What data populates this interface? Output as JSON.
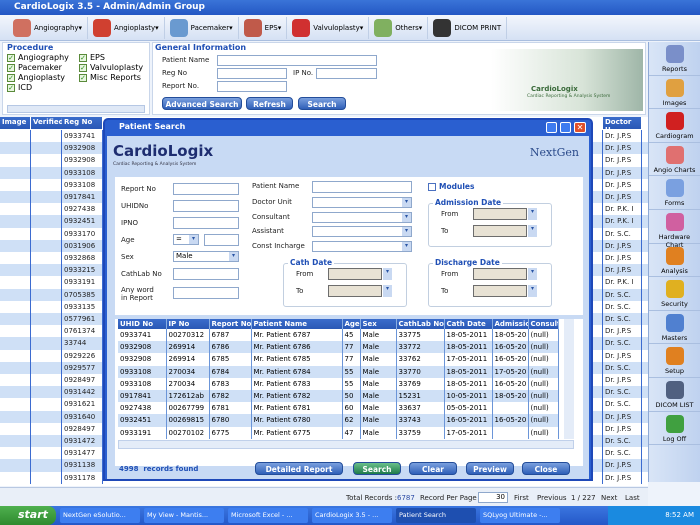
{
  "app": {
    "title": "CardioLogix 3.5 - Admin/Admin Group"
  },
  "toolbar": [
    {
      "label": "Angiography",
      "icon": "heart-angiography-icon",
      "dd": true
    },
    {
      "label": "Angioplasty",
      "icon": "heart-angioplasty-icon",
      "dd": true
    },
    {
      "label": "Pacemaker",
      "icon": "pacemaker-icon",
      "dd": true
    },
    {
      "label": "EPS",
      "icon": "eps-icon",
      "dd": true
    },
    {
      "label": "Valvuloplasty",
      "icon": "valve-icon",
      "dd": true
    },
    {
      "label": "Others",
      "icon": "notepad-icon",
      "dd": true
    },
    {
      "label": "DICOM PRINT",
      "icon": "dicom-grid-icon",
      "dd": false
    }
  ],
  "procedure": {
    "title": "Procedure",
    "items": [
      "Angiography",
      "EPS",
      "Pacemaker",
      "Valvuloplasty",
      "Angioplasty",
      "Misc Reports",
      "ICD"
    ]
  },
  "general": {
    "title": "General Information",
    "patient_name": "Patient Name",
    "reg_no": "Reg No",
    "ip_no": "IP No.",
    "report_no": "Report No.",
    "advanced": "Advanced Search",
    "refresh": "Refresh",
    "search": "Search"
  },
  "banner": {
    "brand": "CardioLogix",
    "sub": "Cardiac Reporting & Analysis System"
  },
  "grid": {
    "headers": [
      "Image",
      "Verified",
      "Reg No",
      "Doctor U"
    ],
    "regno": [
      "0933741",
      "0932908",
      "0932908",
      "0933108",
      "0933108",
      "0917841",
      "0927438",
      "0932451",
      "0933170",
      "0031906",
      "0932868",
      "0933215",
      "0933191",
      "0705385",
      "0933135",
      "0577961",
      "0761374",
      "33744",
      "0929226",
      "0929577",
      "0928497",
      "0931442",
      "0931621",
      "0931640",
      "0928497",
      "0931472",
      "0931477",
      "0931138",
      "0931178"
    ],
    "doctor": [
      "Dr. J.P.S",
      "Dr. J.P.S",
      "Dr. J.P.S",
      "Dr. J.P.S",
      "Dr. J.P.S",
      "Dr. J.P.S",
      "Dr. P.K. I",
      "Dr. P.K. I",
      "Dr. S.C.",
      "Dr. J.P.S",
      "Dr. J.P.S",
      "Dr. J.P.S",
      "Dr. P.K. I",
      "Dr. S.C.",
      "Dr. S.C.",
      "Dr. S.C.",
      "Dr. J.P.S",
      "Dr. S.C.",
      "Dr. J.P.S",
      "Dr. S.C.",
      "Dr. J.P.S",
      "Dr. S.C.",
      "Dr. S.C.",
      "Dr. J.P.S",
      "Dr. J.P.S",
      "Dr. S.C.",
      "Dr. S.C.",
      "Dr. J.P.S",
      "Dr. J.P.S"
    ]
  },
  "sidebar": [
    {
      "label": "Reports",
      "color": "#7a8fc9"
    },
    {
      "label": "Images",
      "color": "#e0a040"
    },
    {
      "label": "Cardiogram",
      "color": "#d02020"
    },
    {
      "label": "Angio Charts",
      "color": "#e07070"
    },
    {
      "label": "Forms",
      "color": "#7aa0e0"
    },
    {
      "label": "Hardware Chart",
      "color": "#d060a0"
    },
    {
      "label": "Analysis",
      "color": "#e08020"
    },
    {
      "label": "Security",
      "color": "#e0b020"
    },
    {
      "label": "Masters",
      "color": "#5080d0"
    },
    {
      "label": "Setup",
      "color": "#e08020"
    },
    {
      "label": "DICOM LIST",
      "color": "#506080"
    },
    {
      "label": "Log Off",
      "color": "#40a040"
    }
  ],
  "dialog": {
    "title": "Patient Search",
    "brand": "CardioLogix",
    "brand_sub": "Cardiac Reporting & Analysis System",
    "partner": "NextGen",
    "labels": {
      "report_no": "Report No",
      "uhid": "UHIDNo",
      "ipno": "IPNO",
      "age": "Age",
      "sex": "Sex",
      "cathlab": "CathLab No",
      "anyword": "Any word in Report",
      "patient_name": "Patient Name",
      "doctor_unit": "Doctor Unit",
      "consultant": "Consultant",
      "assistant": "Assistant",
      "const_incharge": "Const Incharge",
      "modules": "Modules",
      "admission": "Admission Date",
      "cath": "Cath Date",
      "discharge": "Discharge Date",
      "from": "From",
      "to": "To"
    },
    "age_op": "=",
    "sex": "Male",
    "columns": [
      "UHID No",
      "IP No",
      "Report No",
      "Patient Name",
      "Age",
      "Sex",
      "CathLab No",
      "Cath Date",
      "Admission",
      "Consult"
    ],
    "rows": [
      [
        "0933741",
        "00270312",
        "6787",
        "Mr. Patient 6787",
        "45",
        "Male",
        "33775",
        "18-05-2011",
        "18-05-20",
        "(null)"
      ],
      [
        "0932908",
        "269914",
        "6786",
        "Mr. Patient 6786",
        "77",
        "Male",
        "33772",
        "18-05-2011",
        "16-05-20",
        "(null)"
      ],
      [
        "0932908",
        "269914",
        "6785",
        "Mr. Patient 6785",
        "77",
        "Male",
        "33762",
        "17-05-2011",
        "16-05-20",
        "(null)"
      ],
      [
        "0933108",
        "270034",
        "6784",
        "Mr. Patient 6784",
        "55",
        "Male",
        "33770",
        "18-05-2011",
        "17-05-20",
        "(null)"
      ],
      [
        "0933108",
        "270034",
        "6783",
        "Mr. Patient 6783",
        "55",
        "Male",
        "33769",
        "18-05-2011",
        "16-05-20",
        "(null)"
      ],
      [
        "0917841",
        "172612ab",
        "6782",
        "Mr. Patient 6782",
        "50",
        "Male",
        "15231",
        "10-05-2011",
        "18-05-20",
        "(null)"
      ],
      [
        "0927438",
        "00267799",
        "6781",
        "Mr. Patient 6781",
        "60",
        "Male",
        "33637",
        "05-05-2011",
        "",
        "(null)"
      ],
      [
        "0932451",
        "00269815",
        "6780",
        "Mr. Patient 6780",
        "62",
        "Male",
        "33743",
        "16-05-2011",
        "16-05-20",
        "(null)"
      ],
      [
        "0933191",
        "00270102",
        "6775",
        "Mr. Patient 6775",
        "47",
        "Male",
        "33759",
        "17-05-2011",
        "",
        "(null)"
      ],
      [
        "0705385",
        "00269233",
        "6774",
        "Mr. Patient 6774",
        "51",
        "Male",
        "33251",
        "16-05-2011",
        "12-05-20",
        "(null)"
      ]
    ],
    "records_count": "4998",
    "records_label": "records found",
    "buttons": [
      "Detailed Report",
      "Search",
      "Clear",
      "Preview",
      "Close"
    ]
  },
  "status": {
    "total_label": "Total Records :",
    "total": "6787",
    "rpp_label": "Record Per Page :",
    "rpp": "30",
    "first": "First",
    "previous": "Previous",
    "page": "1 / 227",
    "next": "Next",
    "last": "Last"
  },
  "taskbar": {
    "start": "start",
    "tasks": [
      "NextGen eSolutio...",
      "My View - Mantis...",
      "Microsoft Excel - ...",
      "CardioLogix 3.5 - ...",
      "Patient Search",
      "SQLyog Ultimate -..."
    ],
    "time": "8:52 AM"
  }
}
